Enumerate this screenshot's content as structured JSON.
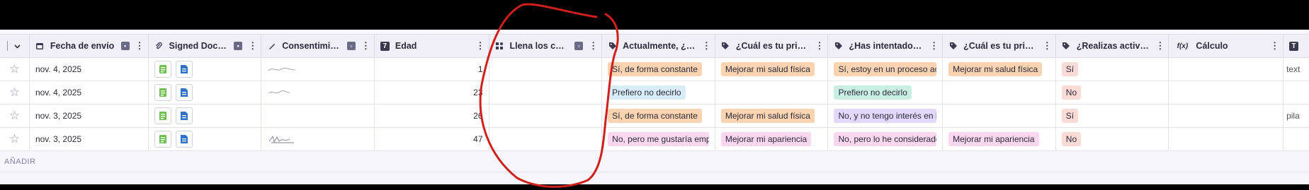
{
  "columns": [
    {
      "label": "",
      "icon": "chevron-down-icon"
    },
    {
      "label": "Fecha de envío",
      "icon": "calendar-icon"
    },
    {
      "label": "Signed Docum...",
      "icon": "paperclip-icon"
    },
    {
      "label": "Consentimient...",
      "icon": "signature-icon"
    },
    {
      "label": "Edad",
      "icon": "number-icon"
    },
    {
      "label": "Llena los camp...",
      "icon": "grid-icon"
    },
    {
      "label": "Actualmente, ¿es...",
      "icon": "tag-icon"
    },
    {
      "label": "¿Cuál es tu princi...",
      "icon": "tag-icon"
    },
    {
      "label": "¿Has intentado p...",
      "icon": "tag-icon"
    },
    {
      "label": "¿Cuál es tu princi...",
      "icon": "tag-icon"
    },
    {
      "label": "¿Realizas activida...",
      "icon": "tag-icon"
    },
    {
      "label": "Cálculo",
      "icon": "formula-icon"
    },
    {
      "label": "",
      "icon": "text-icon"
    }
  ],
  "header_icons": {
    "calendar": "▣",
    "paperclip": "🖇",
    "signature": "✎",
    "number": "7",
    "grid": "▚",
    "tag": "🏷",
    "formula": "f(x)",
    "text": "T",
    "chevron": "⌄"
  },
  "rows": [
    {
      "fecha": "nov. 4, 2025",
      "edad": "1",
      "actualmente": "Sí, de forma constante",
      "principal1": "Mejorar mi salud física",
      "intentado": "Sí, estoy en un proceso acti",
      "principal2": "Mejorar mi salud física",
      "realizas": "Sí",
      "calculo": "",
      "texto": "text"
    },
    {
      "fecha": "nov. 4, 2025",
      "edad": "23",
      "actualmente": "Prefiero no decirlo",
      "principal1": "",
      "intentado": "Prefiero no decirlo",
      "principal2": "",
      "realizas": "No",
      "calculo": "",
      "texto": ""
    },
    {
      "fecha": "nov. 3, 2025",
      "edad": "26",
      "actualmente": "Sí, de forma constante",
      "principal1": "Mejorar mi salud física",
      "intentado": "No, y no tengo interés en ha",
      "principal2": "",
      "realizas": "Sí",
      "calculo": "",
      "texto": "pila"
    },
    {
      "fecha": "nov. 3, 2025",
      "edad": "47",
      "actualmente": "No, pero me gustaría empe",
      "principal1": "Mejorar mi apariencia",
      "intentado": "No, pero lo he considerado",
      "principal2": "Mejorar mi apariencia",
      "realizas": "No",
      "calculo": "",
      "texto": ""
    }
  ],
  "add_label": "AÑADIR",
  "colors": {
    "orange_tag": "#fbd3b0",
    "blue_tag": "#d7ecf7",
    "teal_tag": "#c9efe3",
    "purple_tag": "#e2d8fb",
    "pink_tag": "#fbd6ef",
    "salmon_tag": "#fcdad6",
    "doc_green": "#6fbf4f",
    "doc_blue": "#2f73c9",
    "annotation_red": "#d0201c"
  }
}
